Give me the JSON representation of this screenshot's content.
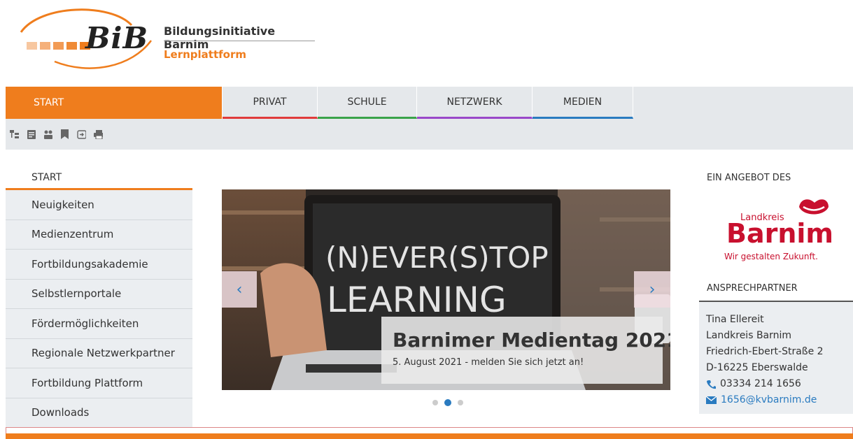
{
  "header": {
    "logo_text": "BiB",
    "title": "Bildungsinitiative Barnim",
    "subtitle": "Lernplattform",
    "logo_square_colors": [
      "#f7c7a0",
      "#f5b07a",
      "#f29b55",
      "#ef8a35",
      "#ef7d1d"
    ]
  },
  "nav": {
    "items": [
      "START",
      "PRIVAT",
      "SCHULE",
      "NETZWERK",
      "MEDIEN"
    ]
  },
  "toolbar": {
    "icons": [
      "sitemap-icon",
      "notes-icon",
      "participants-icon",
      "bookmark-icon",
      "login-icon",
      "print-icon"
    ]
  },
  "sidebar": {
    "heading": "START",
    "items": [
      "Neuigkeiten",
      "Medienzentrum",
      "Fortbildungsakademie",
      "Selbstlernportale",
      "Fördermöglichkeiten",
      "Regionale Netzwerkpartner",
      "Fortbildung Plattform",
      "Downloads"
    ]
  },
  "carousel": {
    "caption_title": "Barnimer Medientag 2021",
    "caption_text": "5. August 2021 - melden Sie sich jetzt an!",
    "slide_count": 3,
    "active_slide": 2
  },
  "right": {
    "offer_heading": "EIN ANGEBOT DES",
    "barnim_small": "Landkreis",
    "barnim_big": "Barnim",
    "barnim_tagline": "Wir gestalten Zukunft.",
    "contact_heading": "ANSPRECHPARTNER",
    "contact": {
      "name": "Tina Ellereit",
      "org": "Landkreis Barnim",
      "street": "Friedrich-Ebert-Straße 2",
      "city": "D-16225 Eberswalde",
      "phone": "03334 214 1656",
      "email": "1656@kvbarnim.de"
    }
  },
  "colors": {
    "accent": "#ef7d1d",
    "link": "#2a7bc0",
    "privat": "#e03b3b",
    "schule": "#3aa34a",
    "netzwerk": "#9a48c9",
    "medien": "#2a7bc0",
    "barnim_red": "#c8102e"
  }
}
